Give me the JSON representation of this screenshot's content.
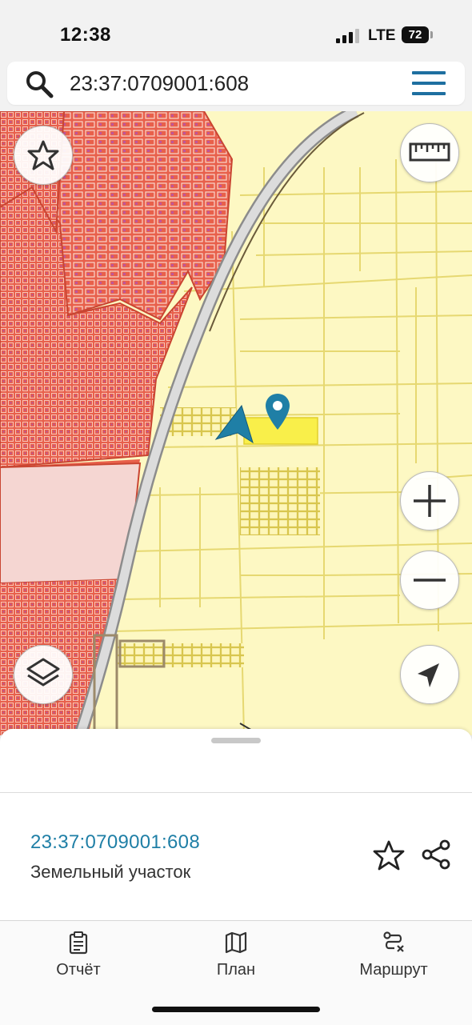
{
  "status_bar": {
    "time": "12:38",
    "network": "LTE",
    "battery": "72"
  },
  "search": {
    "value": "23:37:0709001:608",
    "placeholder": ""
  },
  "map": {
    "icons": {
      "favorite": "star-outline-icon",
      "ruler": "ruler-icon",
      "zoom_in": "plus-icon",
      "zoom_out": "minus-icon",
      "layers": "layers-icon",
      "locate": "navigation-arrow-icon",
      "marker": "map-pin-icon",
      "position": "direction-arrow-icon"
    },
    "colors": {
      "background": "#fdf8c3",
      "parcel_border": "#e3d56a",
      "urban_fill": "#e95f4a",
      "selected_parcel": "#f9ef4a",
      "accent": "#1f7fa6"
    }
  },
  "sheet": {
    "parcel_id": "23:37:0709001:608",
    "parcel_type": "Земельный участок"
  },
  "tabs": [
    {
      "label": "Отчёт",
      "icon": "clipboard-icon"
    },
    {
      "label": "План",
      "icon": "map-icon"
    },
    {
      "label": "Маршрут",
      "icon": "route-icon"
    }
  ]
}
